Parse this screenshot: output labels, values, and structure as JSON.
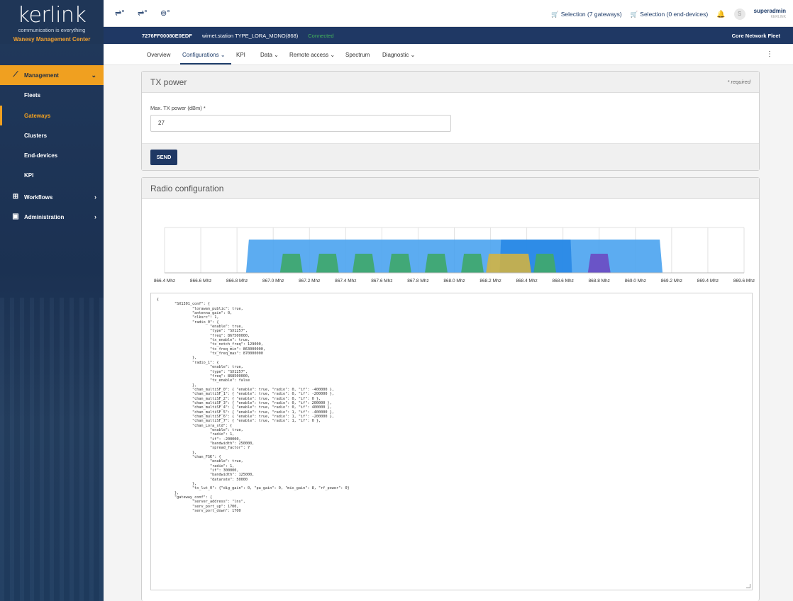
{
  "brand": {
    "logo": "kerlink",
    "tagline": "communication is everything",
    "product": "Wanesy Management Center"
  },
  "sidebar": {
    "management": "Management",
    "sub_items": [
      "Fleets",
      "Gateways",
      "Clusters",
      "End-devices",
      "KPI"
    ],
    "workflows": "Workflows",
    "administration": "Administration"
  },
  "topbar": {
    "selection_gateways": "Selection (7 gateways)",
    "selection_devices": "Selection (0 end-devices)",
    "avatar_letter": "S",
    "user_name": "superadmin",
    "user_org": "KERLINK"
  },
  "infobar": {
    "eui": "7276FF00080E0EDF",
    "station": "wirnet.station TYPE_LORA_MONO(868)",
    "status": "Connected",
    "fleet": "Core Network Fleet"
  },
  "tabs": [
    {
      "label": "Overview",
      "has_menu": false
    },
    {
      "label": "Configurations",
      "has_menu": true
    },
    {
      "label": "KPI",
      "has_menu": false
    },
    {
      "label": "Data",
      "has_menu": true
    },
    {
      "label": "Remote access",
      "has_menu": true
    },
    {
      "label": "Spectrum",
      "has_menu": false
    },
    {
      "label": "Diagnostic",
      "has_menu": true
    }
  ],
  "tx_panel": {
    "title": "TX power",
    "required_note": "* required",
    "field_label": "Max. TX power (dBm) *",
    "field_value": "27",
    "send_label": "SEND"
  },
  "radio_panel": {
    "title": "Radio configuration"
  },
  "colors": {
    "radio_band": "#4aa3ef",
    "radio_band_highlight": "#2b8ae6",
    "channel_green": "#3fa870",
    "channel_yellow": "#d8b43a",
    "channel_purple": "#6a4fc4",
    "accent_orange": "#f0a020",
    "navy": "#1f3864"
  },
  "chart_data": {
    "type": "area",
    "x_unit": "Mhz",
    "xlim": [
      866.4,
      869.6
    ],
    "tick_labels": [
      "866.4 Mhz",
      "866.6 Mhz",
      "866.8 Mhz",
      "867.0 Mhz",
      "867.2 Mhz",
      "867.4 Mhz",
      "867.6 Mhz",
      "867.8 Mhz",
      "868.0 Mhz",
      "868.2 Mhz",
      "868.4 Mhz",
      "868.6 Mhz",
      "868.8 Mhz",
      "869.0 Mhz",
      "869.2 Mhz",
      "869.4 Mhz",
      "869.6 Mhz"
    ],
    "tick_values": [
      866.4,
      866.6,
      866.8,
      867.0,
      867.2,
      867.4,
      867.6,
      867.8,
      868.0,
      868.2,
      868.4,
      868.6,
      868.8,
      869.0,
      869.2,
      869.4,
      869.6
    ],
    "radios": [
      {
        "center": 867.5,
        "low": 866.85,
        "high": 869.15,
        "color": "radio_band"
      },
      {
        "center": 868.5,
        "low": 868.25,
        "high": 868.65,
        "color": "radio_band_highlight"
      }
    ],
    "channels": [
      {
        "freq": 867.1,
        "bw": 0.125,
        "color": "channel_green"
      },
      {
        "freq": 867.3,
        "bw": 0.125,
        "color": "channel_green"
      },
      {
        "freq": 867.5,
        "bw": 0.125,
        "color": "channel_green"
      },
      {
        "freq": 867.7,
        "bw": 0.125,
        "color": "channel_green"
      },
      {
        "freq": 867.9,
        "bw": 0.125,
        "color": "channel_green"
      },
      {
        "freq": 868.1,
        "bw": 0.125,
        "color": "channel_green"
      },
      {
        "freq": 868.3,
        "bw": 0.25,
        "color": "channel_yellow"
      },
      {
        "freq": 868.5,
        "bw": 0.125,
        "color": "channel_green"
      },
      {
        "freq": 868.8,
        "bw": 0.125,
        "color": "channel_purple"
      }
    ]
  },
  "json_text": "{\n        \"SX1301_conf\": {\n                \"lorawan_public\": true,\n                \"antenna_gain\": 0,\n                \"clksrc\": 1,\n                \"radio_0\": {\n                        \"enable\": true,\n                        \"type\": \"SX1257\",\n                        \"freq\": 867500000,\n                        \"tx_enable\": true,\n                        \"tx_notch_freq\": 129000,\n                        \"tx_freq_min\": 863000000,\n                        \"tx_freq_max\": 870000000\n                },\n                \"radio_1\": {\n                        \"enable\": true,\n                        \"type\": \"SX1257\",\n                        \"freq\": 868500000,\n                        \"tx_enable\": false\n                },\n                \"chan_multiSF_0\": { \"enable\": true, \"radio\": 0, \"if\": -400000 },\n                \"chan_multiSF_1\": { \"enable\": true, \"radio\": 0, \"if\": -200000 },\n                \"chan_multiSF_2\": { \"enable\": true, \"radio\": 0, \"if\": 0 },\n                \"chan_multiSF_3\": { \"enable\": true, \"radio\": 0, \"if\": 200000 },\n                \"chan_multiSF_4\": { \"enable\": true, \"radio\": 0, \"if\": 400000 },\n                \"chan_multiSF_5\": { \"enable\": true, \"radio\": 1, \"if\": -400000 },\n                \"chan_multiSF_6\": { \"enable\": true, \"radio\": 1, \"if\": -200000 },\n                \"chan_multiSF_7\": { \"enable\": true, \"radio\": 1, \"if\": 0 },\n                \"chan_Lora_std\": {\n                        \"enable\": true,\n                        \"radio\": 1,\n                        \"if\": -200000,\n                        \"bandwidth\": 250000,\n                        \"spread_factor\": 7\n                },\n                \"chan_FSK\": {\n                        \"enable\": true,\n                        \"radio\": 1,\n                        \"if\": 300000,\n                        \"bandwidth\": 125000,\n                        \"datarate\": 50000\n                },\n                \"tx_lut_0\": {\"dig_gain\": 0, \"pa_gain\": 0, \"mix_gain\": 8, \"rf_power\": 0}\n        },\n        \"gateway_conf\": {\n                \"server_address\": \"lns\",\n                \"serv_port_up\": 1700,\n                \"serv_port_down\": 1700"
}
